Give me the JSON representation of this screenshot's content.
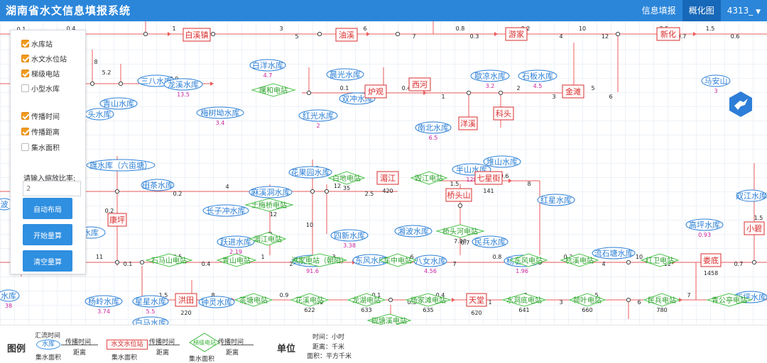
{
  "app": {
    "title": "湖南省水文信息填报系统"
  },
  "nav": {
    "items": [
      "信息填报",
      "概化图"
    ],
    "active": "概化图",
    "user": "4313_"
  },
  "colors": {
    "header": "#2b86da",
    "reservoir": "#2b7fd6",
    "station": "#d93030",
    "hydro": "#2ca02c",
    "flow": "#ee5d5d",
    "value": "#c8229d",
    "button": "#2f8fe0",
    "checkbox": "#f19b1c"
  },
  "panel": {
    "layers": [
      {
        "label": "水库站",
        "checked": true
      },
      {
        "label": "水文水位站",
        "checked": true
      },
      {
        "label": "梯级电站",
        "checked": true
      },
      {
        "label": "小型水库",
        "checked": false
      }
    ],
    "attributes": [
      {
        "label": "传播时间",
        "checked": true
      },
      {
        "label": "传播距离",
        "checked": true
      },
      {
        "label": "集水面积",
        "checked": false
      }
    ],
    "zoom_label": "请输入缩放比率:",
    "zoom_placeholder": "2",
    "buttons": [
      "自动布局",
      "开始量算",
      "清空量算"
    ]
  },
  "map": {
    "stations": [
      {
        "name": "白溪镇",
        "value": ""
      },
      {
        "name": "油溪",
        "value": ""
      },
      {
        "name": "游家",
        "value": ""
      },
      {
        "name": "新化",
        "value": ""
      },
      {
        "name": "西河",
        "value": ""
      },
      {
        "name": "炉观",
        "value": ""
      },
      {
        "name": "金滩",
        "value": ""
      },
      {
        "name": "科头",
        "value": ""
      },
      {
        "name": "洋溪",
        "value": ""
      },
      {
        "name": "湄江",
        "value": "420"
      },
      {
        "name": "七星街",
        "value": "141"
      },
      {
        "name": "桥头山",
        "value": ""
      },
      {
        "name": "康坪",
        "value": ""
      },
      {
        "name": "小碧",
        "value": ""
      },
      {
        "name": "洪田",
        "value": "220"
      },
      {
        "name": "天堂",
        "value": "620"
      },
      {
        "name": "娄底",
        "value": "1458"
      }
    ],
    "reservoirs": [
      {
        "name": "白洋水库",
        "value": "4.7"
      },
      {
        "name": "晨光水库",
        "value": ""
      },
      {
        "name": "歇凉水库",
        "value": "3.2"
      },
      {
        "name": "石板水库",
        "value": "4.5"
      },
      {
        "name": "马安山",
        "value": "3"
      },
      {
        "name": "三八水库",
        "value": ""
      },
      {
        "name": "青山水库",
        "value": ""
      },
      {
        "name": "头水库",
        "value": ""
      },
      {
        "name": "龙溪水库",
        "value": "13.5"
      },
      {
        "name": "双冲水库",
        "value": ""
      },
      {
        "name": "梅树坳水库",
        "value": "3.4"
      },
      {
        "name": "红光水库",
        "value": "2"
      },
      {
        "name": "南北水库",
        "value": "6.5"
      },
      {
        "name": "半山水库",
        "value": "129"
      },
      {
        "name": "堆山水库",
        "value": ""
      },
      {
        "name": "旗水库（六亩塘）",
        "value": ""
      },
      {
        "name": "田茶水库",
        "value": ""
      },
      {
        "name": "花果园水库",
        "value": ""
      },
      {
        "name": "麻溪洞水库",
        "value": "1.44"
      },
      {
        "name": "长子冲水库",
        "value": ""
      },
      {
        "name": "红星水库",
        "value": ""
      },
      {
        "name": "湘波水库",
        "value": ""
      },
      {
        "name": "四新水库",
        "value": "3.38"
      },
      {
        "name": "民兵水库",
        "value": ""
      },
      {
        "name": "跃进水库",
        "value": "2.19"
      },
      {
        "name": "大江口水库",
        "value": "91.6"
      },
      {
        "name": "东风水库",
        "value": ""
      },
      {
        "name": "八女水库",
        "value": "4.56"
      },
      {
        "name": "杨名水库",
        "value": "1.96"
      },
      {
        "name": "流石塘水库",
        "value": ""
      },
      {
        "name": "双江水库",
        "value": ""
      },
      {
        "name": "高坪水库",
        "value": "0.93"
      },
      {
        "name": "水库",
        "value": ""
      },
      {
        "name": "波",
        "value": ""
      },
      {
        "name": "杨岭水库",
        "value": "3.74"
      },
      {
        "name": "星星水库",
        "value": "5.5"
      },
      {
        "name": "白马水库",
        "value": "285"
      },
      {
        "name": "钟灵水库",
        "value": ""
      },
      {
        "name": "新坪水库",
        "value": ""
      },
      {
        "name": "工农水库",
        "value": ""
      },
      {
        "name": "杨柳水库",
        "value": ""
      },
      {
        "name": "水库",
        "value": "38"
      }
    ],
    "hydro": [
      {
        "name": "曙和电站",
        "value": ""
      },
      {
        "name": "白地电站",
        "value": "35"
      },
      {
        "name": "毁江电站",
        "value": ""
      },
      {
        "name": "土梅桥电站",
        "value": ""
      },
      {
        "name": "湄江电站",
        "value": ""
      },
      {
        "name": "桥头河电站",
        "value": "7.88"
      },
      {
        "name": "石马山电站",
        "value": ""
      },
      {
        "name": "青山电站",
        "value": ""
      },
      {
        "name": "洪家电站（朝阳）",
        "value": ""
      },
      {
        "name": "车中电站",
        "value": ""
      },
      {
        "name": "东风电站",
        "value": ""
      },
      {
        "name": "杭溪电站",
        "value": ""
      },
      {
        "name": "红卫电站",
        "value": ""
      },
      {
        "name": "茶塘电站",
        "value": ""
      },
      {
        "name": "花溪电站",
        "value": "622"
      },
      {
        "name": "龙湖电站",
        "value": "633"
      },
      {
        "name": "杨家滩电站",
        "value": "635"
      },
      {
        "name": "水洞底电站",
        "value": "641"
      },
      {
        "name": "荷叶电站",
        "value": "660"
      },
      {
        "name": "民兵电站",
        "value": "780"
      },
      {
        "name": "青公亭电站",
        "value": ""
      },
      {
        "name": "砚塘溪电站",
        "value": ""
      }
    ],
    "flow_labels": [
      "0.1",
      "0.5",
      "0.4",
      "1",
      "2",
      "3",
      "5",
      "6",
      "7",
      "0.8",
      "0.3",
      "0.2",
      "4",
      "10",
      "12",
      "2.5",
      "0.7",
      "1.5",
      "0.6",
      "8",
      "5.2",
      "0.9",
      "11"
    ]
  },
  "legend": {
    "title": "图例",
    "items": [
      {
        "top": "汇流时间",
        "shape_label": "水库",
        "mid": "传播时间",
        "bottom": "集水面积",
        "dist": "距离"
      },
      {
        "top": "",
        "shape_label": "水文水位站",
        "mid": "传播时间",
        "bottom": "集水面积",
        "dist": "距离"
      },
      {
        "top": "",
        "shape_label": "梯级电站",
        "mid": "传播时间",
        "bottom": "集水面积",
        "dist": "距离"
      }
    ],
    "units_title": "单位",
    "units": [
      "时间：小时",
      "距离：千米",
      "面积：平方千米"
    ]
  }
}
